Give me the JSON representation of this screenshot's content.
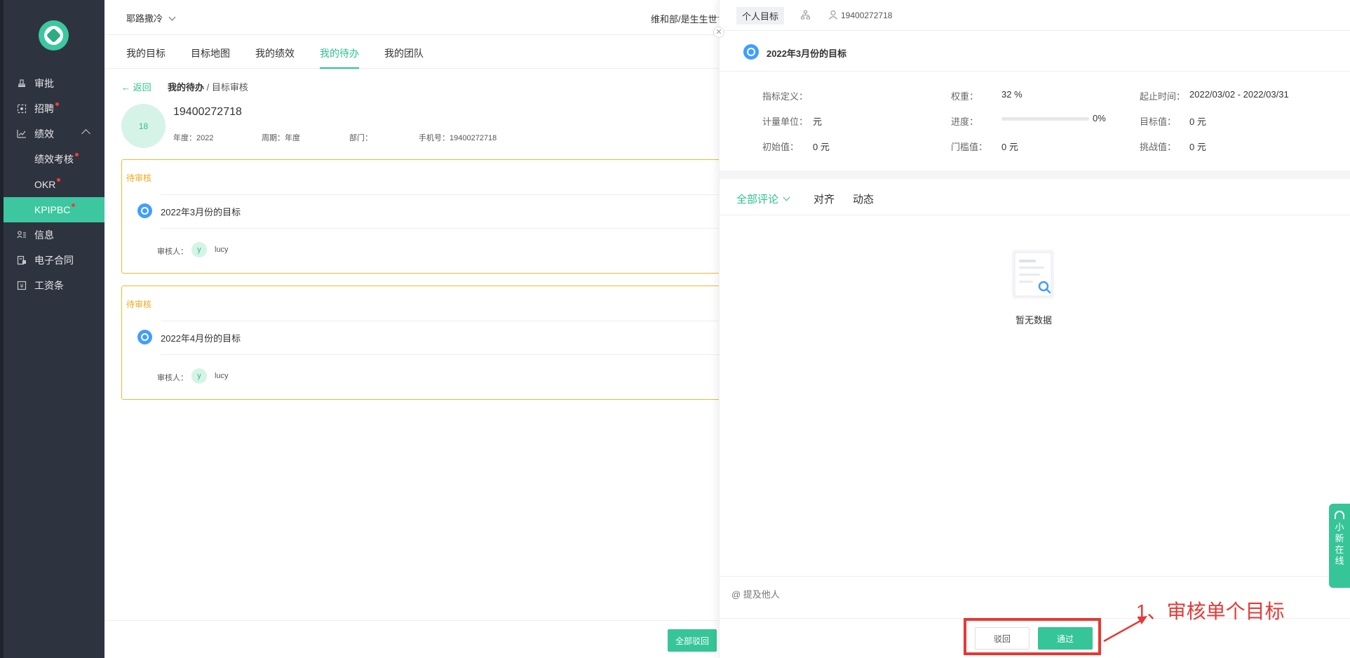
{
  "sidebar": {
    "items": [
      {
        "label": "审批",
        "icon": "stamp-icon"
      },
      {
        "label": "招聘",
        "icon": "recruit-icon",
        "dot": true
      },
      {
        "label": "绩效",
        "icon": "chart-line-icon",
        "expanded": true
      },
      {
        "label": "绩效考核",
        "sub": true,
        "dot": true
      },
      {
        "label": "OKR",
        "sub": true,
        "dot": true
      },
      {
        "label": "KPIPBC",
        "sub": true,
        "dot": true,
        "active": true
      },
      {
        "label": "信息",
        "icon": "info-user-icon"
      },
      {
        "label": "电子合同",
        "icon": "contract-icon"
      },
      {
        "label": "工资条",
        "icon": "payslip-icon"
      }
    ]
  },
  "header": {
    "company": "耶路撒冷",
    "dept": "维和部/是生生世世"
  },
  "tabs": [
    "我的目标",
    "目标地图",
    "我的绩效",
    "我的待办",
    "我的团队"
  ],
  "active_tab": "我的待办",
  "breadcrumb": {
    "back": "← 返回",
    "parent": "我的待办",
    "sep": " / ",
    "current": "目标审核"
  },
  "user": {
    "avatar": "18",
    "id": "19400272718",
    "year": "年度：2022",
    "period": "周期：年度",
    "dept": "部门：",
    "phone": "手机号：19400272718"
  },
  "cards": [
    {
      "status": "待审核",
      "title": "2022年3月份的目标",
      "reviewer_label": "审核人：",
      "reviewer_avatar": "y",
      "reviewer": "lucy"
    },
    {
      "status": "待审核",
      "title": "2022年4月份的目标",
      "reviewer_label": "审核人：",
      "reviewer_avatar": "y",
      "reviewer": "lucy"
    }
  ],
  "bottom": {
    "reject_all": "全部驳回"
  },
  "drawer": {
    "tab_personal": "个人目标",
    "tab_user": "19400272718",
    "goal_title": "2022年3月份的目标",
    "fields": {
      "definition_label": "指标定义：",
      "weight_label": "权重：",
      "weight": "32 %",
      "time_label": "起止时间：",
      "time": "2022/03/02 - 2022/03/31",
      "unit_label": "计量单位：",
      "unit": "元",
      "progress_label": "进度：",
      "progress": 0,
      "progress_text": "0%",
      "target_label": "目标值：",
      "target": "0 元",
      "initial_label": "初始值：",
      "initial": "0 元",
      "threshold_label": "门槛值：",
      "threshold": "0 元",
      "challenge_label": "挑战值：",
      "challenge": "0 元"
    },
    "comment_tabs": {
      "all": "全部评论",
      "align": "对齐",
      "activity": "动态"
    },
    "empty": "暂无数据",
    "mention_placeholder": "@ 提及他人",
    "reject": "驳回",
    "pass": "通过"
  },
  "annotation": "1、审核单个目标",
  "online_service": [
    "小",
    "新",
    "在",
    "线"
  ],
  "colors": {
    "accent": "#36c597",
    "sidebar": "#2e3340",
    "pending": "#f5b731",
    "annotation": "#e53935"
  }
}
